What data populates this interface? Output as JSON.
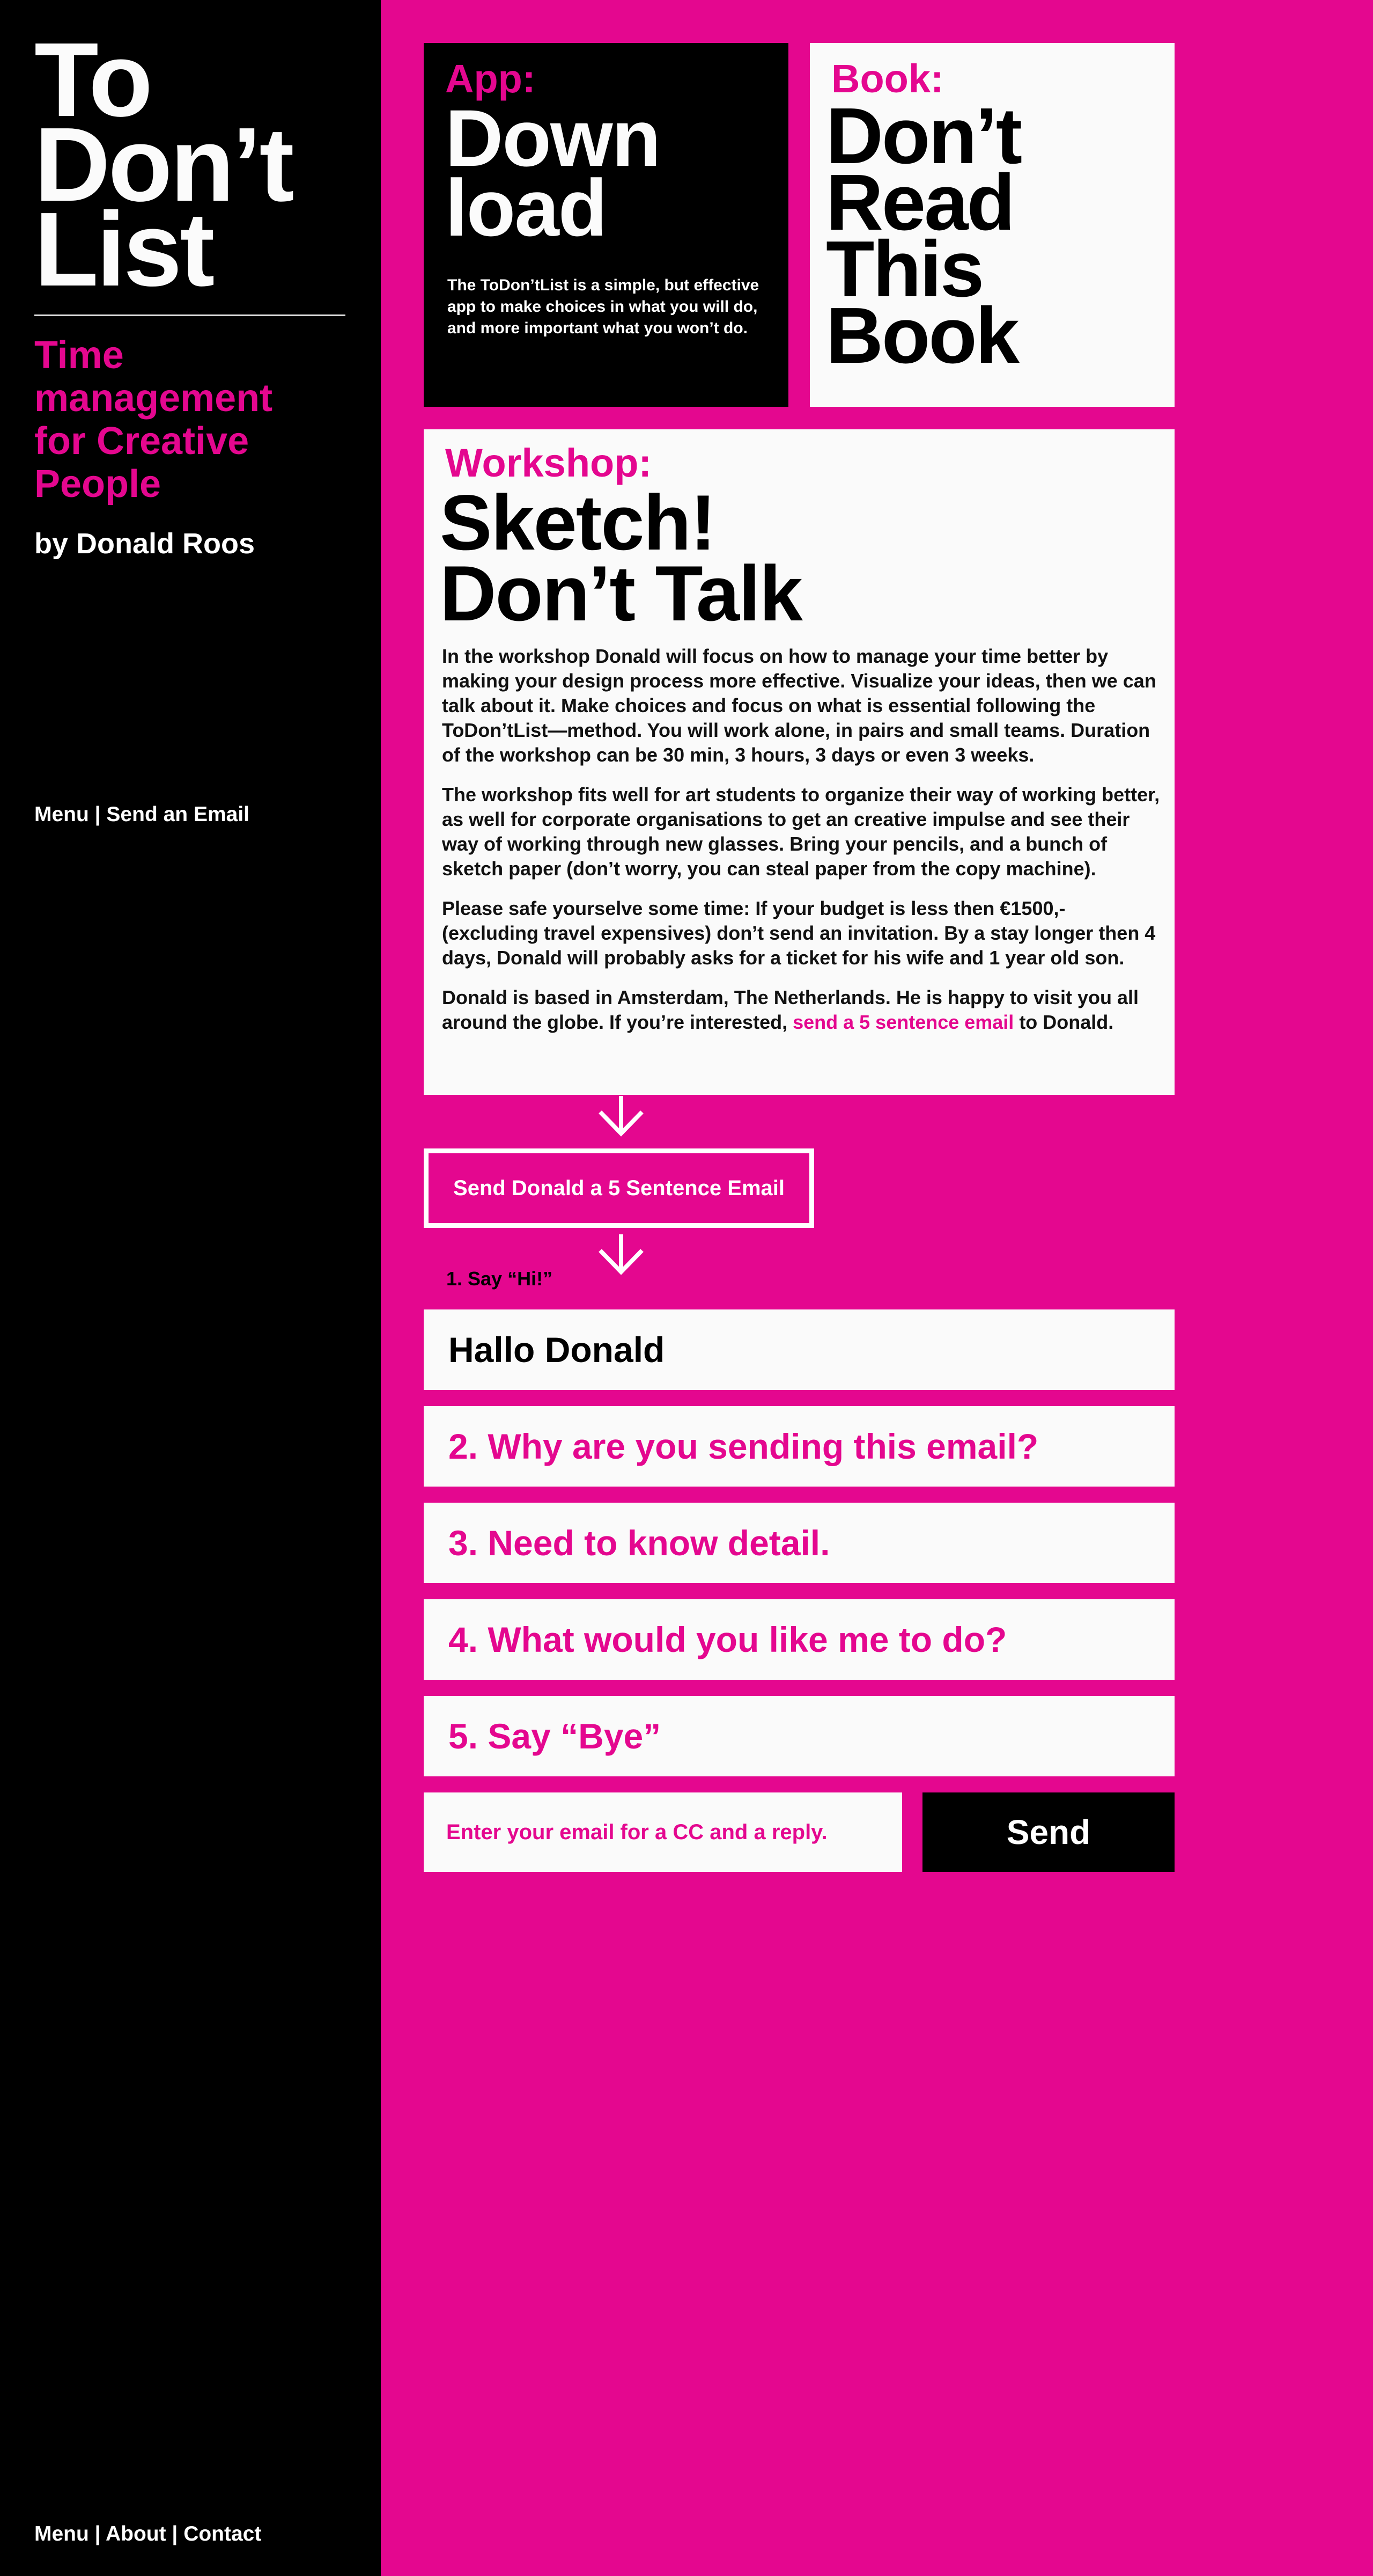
{
  "sidebar": {
    "title_lines": [
      "To",
      "Don’t",
      "List"
    ],
    "tagline": "Time management for Creative People",
    "byline": "by Donald Roos",
    "top_nav": {
      "menu": "Menu",
      "separator": " | ",
      "send_email": "Send an Email"
    },
    "bottom_nav": {
      "menu": "Menu",
      "separator": " | ",
      "about": "About",
      "contact": "Contact"
    }
  },
  "app_card": {
    "kicker": "App:",
    "heading_lines": [
      "Down",
      "load"
    ],
    "text": "The ToDon’tList is a simple, but effective app to make choices in what you will do, and more important what you won’t do."
  },
  "book_card": {
    "kicker": "Book:",
    "heading_lines": [
      "Don’t",
      "Read",
      "This",
      "Book"
    ]
  },
  "workshop_card": {
    "kicker": "Workshop:",
    "heading_lines": [
      "Sketch!",
      "Don’t Talk"
    ],
    "paragraphs": [
      "In the workshop Donald will focus on how to manage your time better by making your design process more effective. Visualize your ideas, then we can talk about it. Make choices and focus on what is essential following the ToDon’tList—method. You will work alone, in pairs and small teams. Duration of the workshop can be 30 min, 3 hours, 3 days or even 3 weeks.",
      "The workshop fits well for art students to organize their way of working better, as well for corporate organisations to get an creative impulse and see their way of working through new glasses. Bring your pencils, and a bunch of sketch paper (don’t worry, you can steal paper from the copy machine).",
      "Please safe yourselve some time: If your budget is less then €1500,- (excluding travel expensives) don’t send an invitation. By a stay longer then 4 days, Donald will probably asks for a ticket for his wife and 1 year old son."
    ],
    "last_paragraph_before": "Donald is based in Amsterdam, The Netherlands. He is happy to visit you all around the globe. If you’re interested, ",
    "last_paragraph_link": "send a 5 sentence email",
    "last_paragraph_after": " to Donald."
  },
  "email_form": {
    "cta_label": "Send Donald a 5 Sentence Email",
    "step1_label": "1. Say “Hi!”",
    "field1_value": "Hallo Donald",
    "field2_placeholder": "2. Why are you sending this email?",
    "field3_placeholder": "3. Need to know detail.",
    "field4_placeholder": "4. What would you like me to do?",
    "field5_placeholder": "5. Say “Bye”",
    "email_placeholder": "Enter your email for a CC and a reply.",
    "send_label": "Send"
  },
  "colors": {
    "accent": "#e4078f",
    "sidebar_bg": "#000000",
    "card_bg": "#fafafa"
  },
  "icons": [
    "arrow-down-icon"
  ]
}
